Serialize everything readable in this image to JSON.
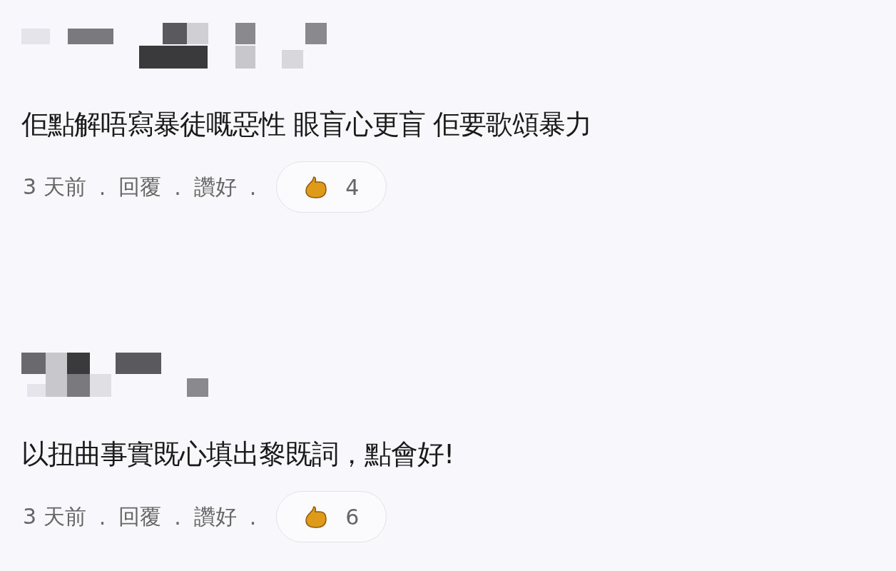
{
  "separator": ".",
  "comments": [
    {
      "text": "佢點解唔寫暴徒嘅惡性 眼盲心更盲 佢要歌頌暴力",
      "time": "3 天前",
      "actions": [
        "回覆",
        "讚好"
      ],
      "likes": "4"
    },
    {
      "text": "以扭曲事實既心填出黎既詞，點會好!",
      "time": "3 天前",
      "actions": [
        "回覆",
        "讚好"
      ],
      "likes": "6"
    }
  ]
}
